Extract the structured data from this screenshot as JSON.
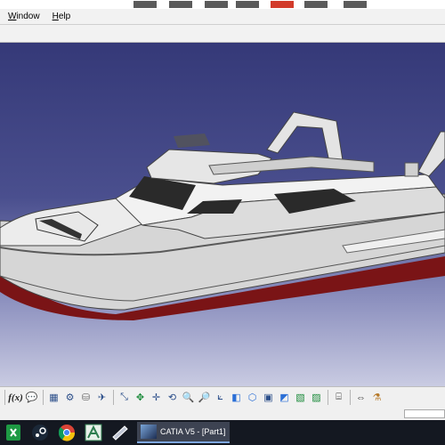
{
  "menu": {
    "items": [
      "Window",
      "Help"
    ]
  },
  "viewport": {
    "model": "motor-yacht-3d-model",
    "background_top": "#353978",
    "background_bottom": "#c9cbe2",
    "hull_color": "#d8d8d8",
    "bottom_color": "#7a1416"
  },
  "toolbar": {
    "formula_label": "f(x)",
    "tools": [
      "formula-icon",
      "comment-icon",
      "table-icon",
      "tree-icon",
      "knowledge-icon",
      "fly-mode-icon",
      "fit-all-icon",
      "pan-icon",
      "rotate-icon",
      "zoom-in-icon",
      "zoom-out-icon",
      "normal-view-icon",
      "iso-view-icon",
      "render-style-icon",
      "hide-show-icon",
      "swap-visible-icon",
      "camera-icon",
      "measure-icon",
      "apply-material-icon"
    ]
  },
  "taskbar": {
    "apps": [
      "spreadsheet-app-icon",
      "steam-icon",
      "chrome-icon",
      "drawing-app-icon",
      "pen-tablet-icon"
    ],
    "active_window_label": "CATIA V5 - [Part1]"
  },
  "colors": {
    "accent": "#2c4f8a",
    "taskbar": "#141821"
  }
}
